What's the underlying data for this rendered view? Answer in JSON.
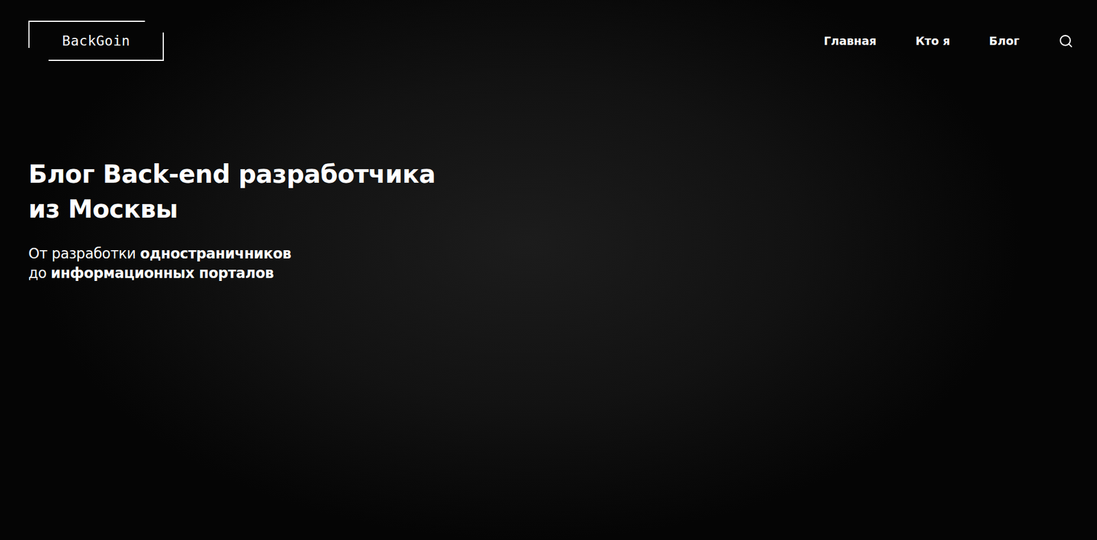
{
  "logo": {
    "text": "BackGoin"
  },
  "nav": {
    "items": [
      {
        "label": "Главная"
      },
      {
        "label": "Кто я"
      },
      {
        "label": "Блог"
      }
    ],
    "search": {
      "label": ""
    }
  },
  "hero": {
    "title_lines": [
      "Блог Back-end разработчика",
      "из Москвы"
    ],
    "subtitle_lines": [
      [
        {
          "text": "От разработки ",
          "emphasis": false
        },
        {
          "text": "одностраничников",
          "emphasis": true
        }
      ],
      [
        {
          "text": "до ",
          "emphasis": false
        },
        {
          "text": "информационных порталов",
          "emphasis": true
        }
      ]
    ]
  }
}
